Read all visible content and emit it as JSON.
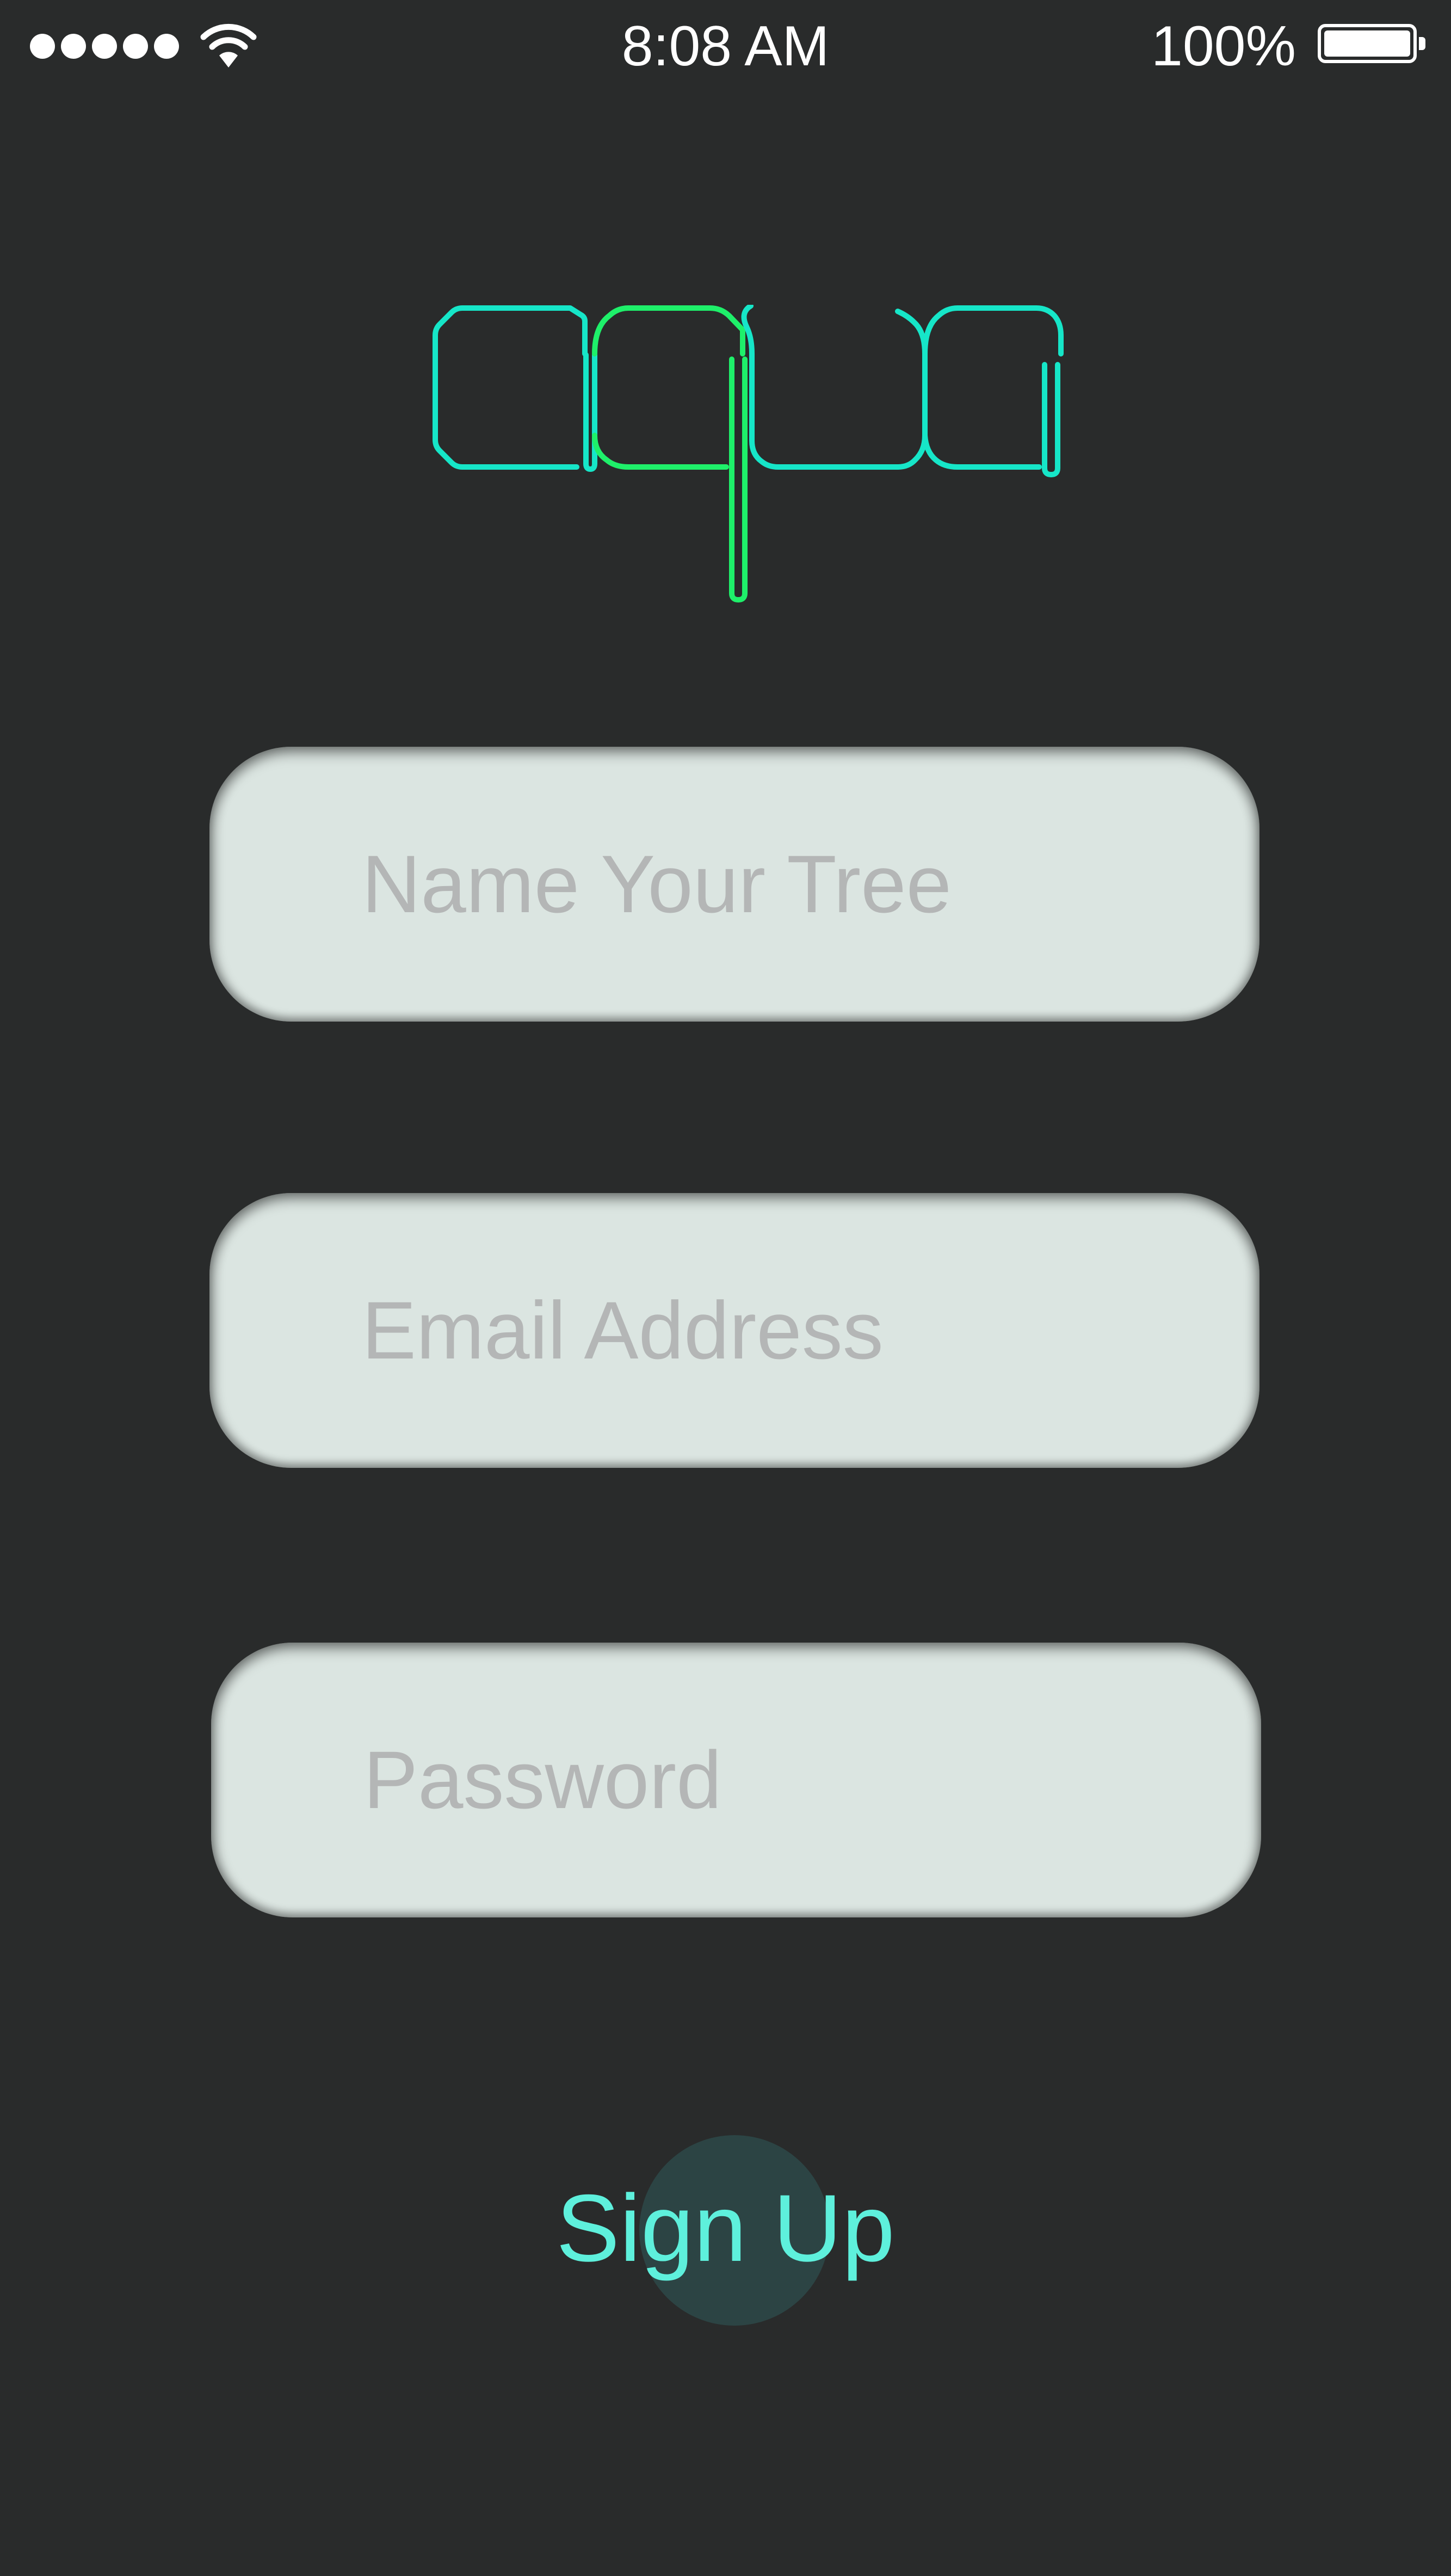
{
  "status_bar": {
    "time": "8:08 AM",
    "battery_percent": "100%",
    "signal_icon": "signal-dots-icon",
    "wifi_icon": "wifi-icon",
    "battery_icon": "battery-icon"
  },
  "logo": {
    "text": "aqua",
    "colors": {
      "teal": "#16e6c8",
      "green": "#1ef06a"
    }
  },
  "form": {
    "tree_name": {
      "placeholder": "Name Your Tree",
      "value": ""
    },
    "email": {
      "placeholder": "Email Address",
      "value": ""
    },
    "password": {
      "placeholder": "Password",
      "value": ""
    }
  },
  "signup": {
    "label": "Sign Up",
    "color": "#5ef0dc"
  },
  "theme": {
    "background": "#292b2b",
    "field_background": "#dbe5e1"
  }
}
